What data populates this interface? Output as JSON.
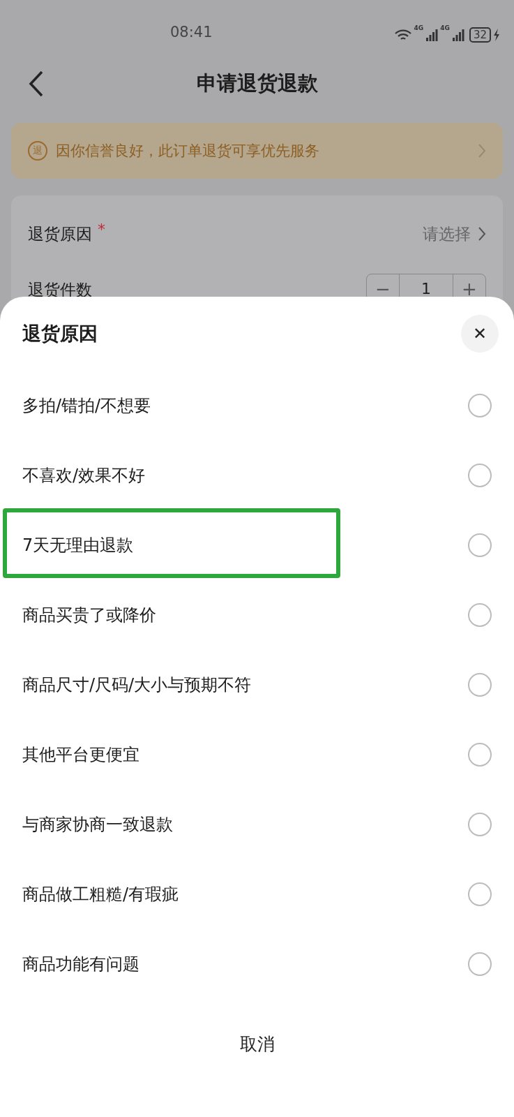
{
  "status_bar": {
    "time": "08:41",
    "networks": [
      "4G",
      "4G"
    ],
    "battery": "32"
  },
  "header": {
    "title": "申请退货退款"
  },
  "banner": {
    "text": "因你信誉良好，此订单退货可享优先服务",
    "icon_text": "退"
  },
  "form": {
    "reason_label": "退货原因",
    "required_mark": "*",
    "reason_value": "请选择",
    "count_label": "退货件数",
    "stepper": {
      "minus": "−",
      "value": "1",
      "plus": "+"
    }
  },
  "sheet": {
    "title": "退货原因",
    "close": "✕",
    "cancel": "取消",
    "reasons": [
      {
        "label": "多拍/错拍/不想要",
        "selected": false,
        "highlighted": false
      },
      {
        "label": "不喜欢/效果不好",
        "selected": false,
        "highlighted": false
      },
      {
        "label": "7天无理由退款",
        "selected": false,
        "highlighted": true
      },
      {
        "label": "商品买贵了或降价",
        "selected": false,
        "highlighted": false
      },
      {
        "label": "商品尺寸/尺码/大小与预期不符",
        "selected": false,
        "highlighted": false
      },
      {
        "label": "其他平台更便宜",
        "selected": false,
        "highlighted": false
      },
      {
        "label": "与商家协商一致退款",
        "selected": false,
        "highlighted": false
      },
      {
        "label": "商品做工粗糙/有瑕疵",
        "selected": false,
        "highlighted": false
      },
      {
        "label": "商品功能有问题",
        "selected": false,
        "highlighted": false
      }
    ]
  }
}
